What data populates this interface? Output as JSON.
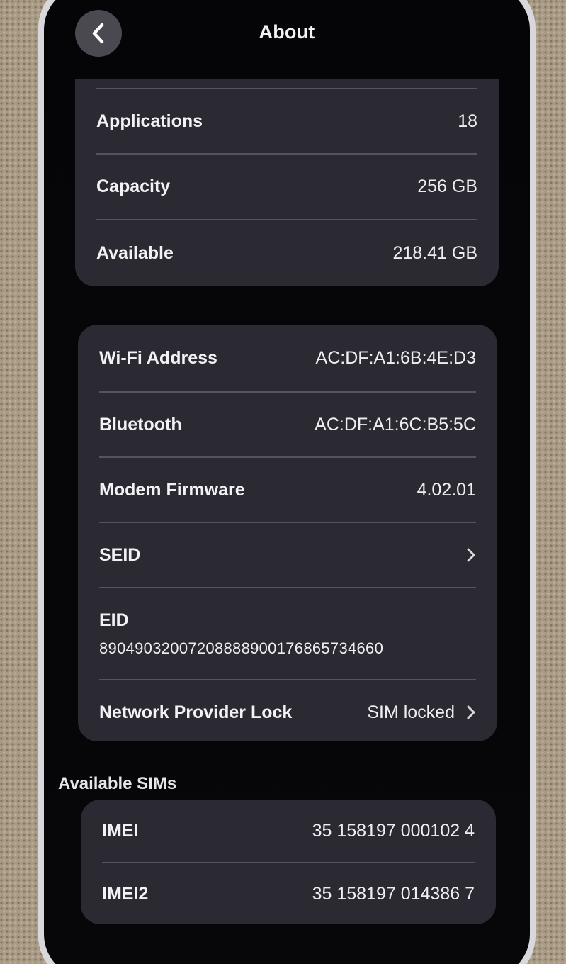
{
  "nav": {
    "title": "About"
  },
  "storage": {
    "applications_label": "Applications",
    "applications_value": "18",
    "capacity_label": "Capacity",
    "capacity_value": "256 GB",
    "available_label": "Available",
    "available_value": "218.41 GB"
  },
  "network": {
    "wifi_label": "Wi-Fi Address",
    "wifi_value": "AC:DF:A1:6B:4E:D3",
    "bluetooth_label": "Bluetooth",
    "bluetooth_value": "AC:DF:A1:6C:B5:5C",
    "modem_label": "Modem Firmware",
    "modem_value": "4.02.01",
    "seid_label": "SEID",
    "eid_label": "EID",
    "eid_value": "89049032007208888900176865734660",
    "lock_label": "Network Provider Lock",
    "lock_value": "SIM locked"
  },
  "sims": {
    "header": "Available SIMs",
    "imei_label": "IMEI",
    "imei_value": "35 158197 000102 4",
    "imei2_label": "IMEI2",
    "imei2_value": "35 158197 014386 7"
  },
  "icons": {
    "back": "chevron-left-icon",
    "disclosure": "chevron-right-icon"
  }
}
